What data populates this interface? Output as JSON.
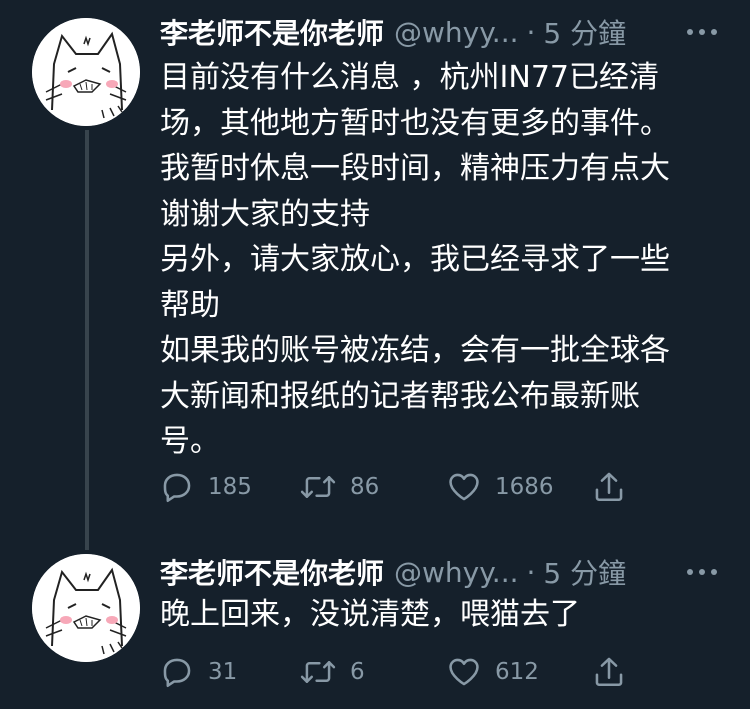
{
  "tweets": [
    {
      "display_name": "李老师不是你老师",
      "handle": "@whyy...",
      "separator": "·",
      "time": "5 分鐘",
      "text": "目前没有什么消息 ，杭州IN77已经清\n场，其他地方暂时也没有更多的事件。\n我暂时休息一段时间，精神压力有点大\n谢谢大家的支持\n另外，请大家放心，我已经寻求了一些\n帮助\n如果我的账号被冻结，会有一批全球各\n大新闻和报纸的记者帮我公布最新账\n号。",
      "replies": "185",
      "retweets": "86",
      "likes": "1686"
    },
    {
      "display_name": "李老师不是你老师",
      "handle": "@whyy...",
      "separator": "·",
      "time": "5 分鐘",
      "text": "晚上回来，没说清楚，喂猫去了",
      "replies": "31",
      "retweets": "6",
      "likes": "612"
    }
  ],
  "colors": {
    "background": "#15202b",
    "text": "#ffffff",
    "secondary": "#8899a6",
    "thread_line": "#38444d"
  },
  "icons": [
    "cat-avatar",
    "more-icon",
    "reply-icon",
    "retweet-icon",
    "like-icon",
    "share-icon"
  ]
}
